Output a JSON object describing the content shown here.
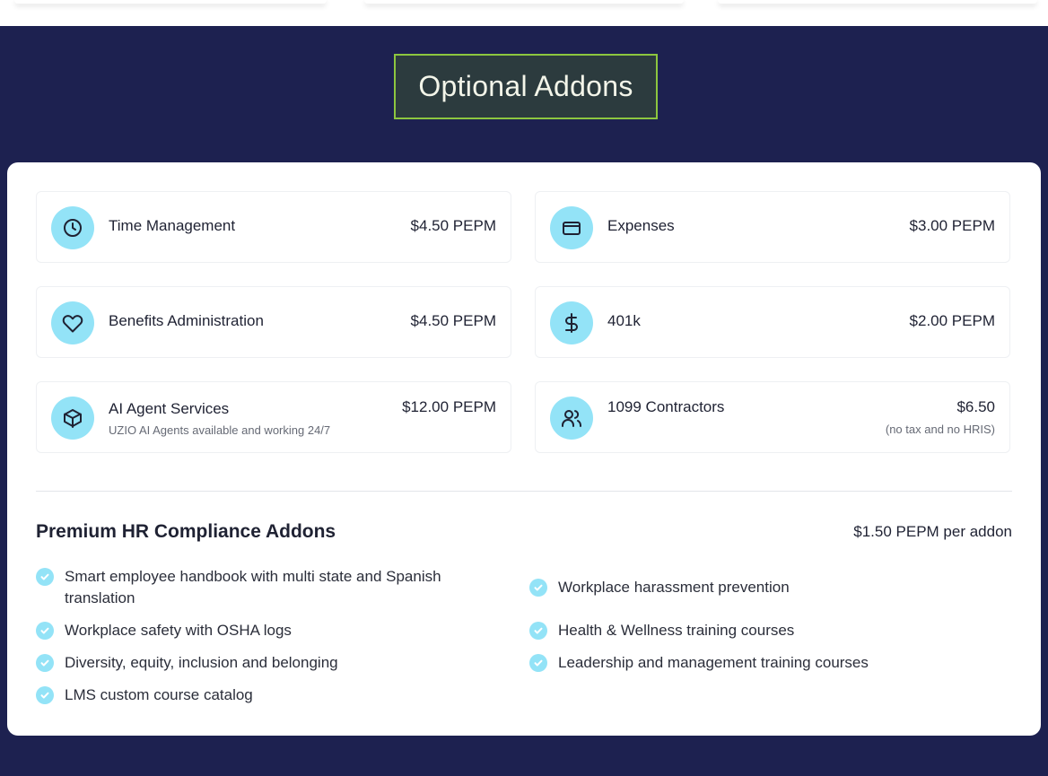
{
  "header": {
    "title": "Optional Addons"
  },
  "addons": [
    {
      "name": "Time Management",
      "price": "$4.50 PEPM",
      "icon": "clock-icon"
    },
    {
      "name": "Expenses",
      "price": "$3.00 PEPM",
      "icon": "credit-card-icon"
    },
    {
      "name": "Benefits Administration",
      "price": "$4.50 PEPM",
      "icon": "heart-icon"
    },
    {
      "name": "401k",
      "price": "$2.00 PEPM",
      "icon": "dollar-icon"
    },
    {
      "name": "AI Agent Services",
      "price": "$12.00 PEPM",
      "subtitle": "UZIO AI Agents available and working 24/7",
      "icon": "box-icon"
    },
    {
      "name": "1099 Contractors",
      "price": "$6.50",
      "note": "(no tax and no HRIS)",
      "icon": "users-icon"
    }
  ],
  "premium": {
    "title": "Premium HR Compliance Addons",
    "price": "$1.50 PEPM per addon",
    "features_left": [
      "Smart employee handbook with multi state and Spanish translation",
      "Workplace safety with OSHA logs",
      "Diversity, equity, inclusion and belonging",
      "LMS custom course catalog"
    ],
    "features_right": [
      "Workplace harassment prevention",
      "Health & Wellness training courses",
      "Leadership and management training courses"
    ]
  },
  "colors": {
    "background": "#1d2150",
    "accent": "#93e3f7",
    "title_border": "#8dc63f"
  }
}
